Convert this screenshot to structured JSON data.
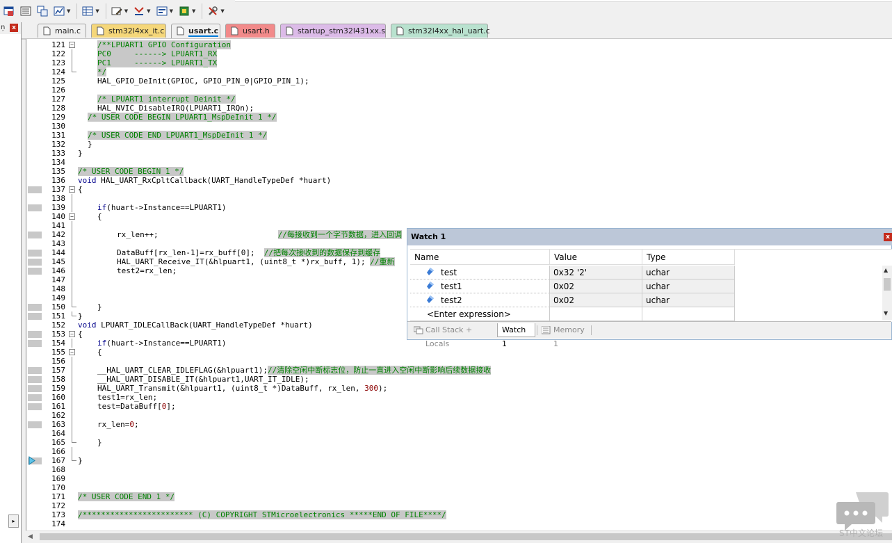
{
  "toolbar": {
    "icons": [
      "window-icon",
      "list-icon",
      "registers-icon",
      "disassembly-icon",
      "grid-icon",
      "memory-icon",
      "callstack-icon",
      "watch-icon",
      "cpu-icon",
      "tools-icon"
    ]
  },
  "left_panel": {
    "pin": "ņ",
    "close": "x",
    "scroll": "▸"
  },
  "tabs": [
    {
      "label": "main.c",
      "color": "#f0f0f0"
    },
    {
      "label": "stm32l4xx_it.c",
      "color": "#f5d77a"
    },
    {
      "label": "usart.c",
      "color": "#f0f0f0",
      "active": true
    },
    {
      "label": "usart.h",
      "color": "#f28a8a"
    },
    {
      "label": "startup_stm32l431xx.s",
      "color": "#dcbbe8"
    },
    {
      "label": "stm32l4xx_hal_uart.c",
      "color": "#b9e2cf"
    }
  ],
  "code": {
    "l121_n": "121",
    "l121": "/**LPUART1 GPIO Configuration",
    "l122_n": "122",
    "l122": "PC0     ------> LPUART1_RX",
    "l123_n": "123",
    "l123": "PC1     ------> LPUART1_TX",
    "l124_n": "124",
    "l124": "*/",
    "l125_n": "125",
    "l125": "HAL_GPIO_DeInit(GPIOC, GPIO_PIN_0|GPIO_PIN_1);",
    "l126_n": "126",
    "l127_n": "127",
    "l127": "/* LPUART1 interrupt Deinit */",
    "l128_n": "128",
    "l128": "HAL_NVIC_DisableIRQ(LPUART1_IRQn);",
    "l129_n": "129",
    "l129": "/* USER CODE BEGIN LPUART1_MspDeInit 1 */",
    "l130_n": "130",
    "l131_n": "131",
    "l131": "/* USER CODE END LPUART1_MspDeInit 1 */",
    "l132_n": "132",
    "l132": "}",
    "l133_n": "133",
    "l133": "}",
    "l134_n": "134",
    "l135_n": "135",
    "l135": "/* USER CODE BEGIN 1 */",
    "l136_n": "136",
    "l136_kw": "void",
    "l136": " HAL_UART_RxCpltCallback(UART_HandleTypeDef *huart)",
    "l137_n": "137",
    "l137": "{",
    "l138_n": "138",
    "l139_n": "139",
    "l139_kw": "if",
    "l139": "(huart->Instance==LPUART1)",
    "l140_n": "140",
    "l140": "{",
    "l141_n": "141",
    "l142_n": "142",
    "l142": "rx_len++;                          ",
    "l142_cm": "//每接收到一个字节数据，进入回调",
    "l143_n": "143",
    "l144_n": "144",
    "l144": "DataBuff[rx_len-1]=rx_buff[0];  ",
    "l144_cm": "//把每次接收到的数据保存到缓存",
    "l145_n": "145",
    "l145": "HAL_UART_Receive_IT(&hlpuart1, (uint8_t *)rx_buff, 1); ",
    "l145_num": "1",
    "l145_cm": "//重新",
    "l146_n": "146",
    "l146": "test2=rx_len;",
    "l147_n": "147",
    "l148_n": "148",
    "l149_n": "149",
    "l150_n": "150",
    "l150": "}",
    "l151_n": "151",
    "l151": "}",
    "l152_n": "152",
    "l152_kw": "void",
    "l152": " LPUART_IDLECallBack(UART_HandleTypeDef *huart)",
    "l153_n": "153",
    "l153": "{",
    "l154_n": "154",
    "l154_kw": "if",
    "l154": "(huart->Instance==LPUART1)",
    "l155_n": "155",
    "l155": "{",
    "l156_n": "156",
    "l157_n": "157",
    "l157": "__HAL_UART_CLEAR_IDLEFLAG(&hlpuart1);",
    "l157_cm": "//清除空闲中断标志位，防止一直进入空闲中断影响后续数据接收",
    "l158_n": "158",
    "l158": "__HAL_UART_DISABLE_IT(&hlpuart1,UART_IT_IDLE);",
    "l159_n": "159",
    "l159": "HAL_UART_Transmit(&hlpuart1, (uint8_t *)DataBuff, rx_len, ",
    "l159_num": "300",
    "l159_end": ");",
    "l160_n": "160",
    "l160": "test1=rx_len;",
    "l161_n": "161",
    "l161": "test=DataBuff[",
    "l161_num": "0",
    "l161_end": "];",
    "l162_n": "162",
    "l163_n": "163",
    "l163": "rx_len=",
    "l163_num": "0",
    "l163_end": ";",
    "l164_n": "164",
    "l165_n": "165",
    "l165": "}",
    "l166_n": "166",
    "l167_n": "167",
    "l167": "}",
    "l168_n": "168",
    "l169_n": "169",
    "l170_n": "170",
    "l171_n": "171",
    "l171": "/* USER CODE END 1 */",
    "l172_n": "172",
    "l173_n": "173",
    "l173": "/************************ (C) COPYRIGHT STMicroelectronics *****END OF FILE****/",
    "l174_n": "174"
  },
  "watch": {
    "title": "Watch 1",
    "close": "x",
    "columns": {
      "name": "Name",
      "value": "Value",
      "type": "Type"
    },
    "rows": [
      {
        "name": "test",
        "value": "0x32 '2'",
        "type": "uchar"
      },
      {
        "name": "test1",
        "value": "0x02",
        "type": "uchar"
      },
      {
        "name": "test2",
        "value": "0x02",
        "type": "uchar"
      }
    ],
    "enter_expression": "<Enter expression>",
    "tabs": {
      "callstack": "Call Stack + Locals",
      "watch": "Watch 1",
      "memory": "Memory 1"
    }
  },
  "brand": "ST中文论坛",
  "colors": {
    "comment": "#008000",
    "keyword": "#00008b",
    "number": "#8b0000",
    "highlight": "#c8c8c8",
    "watch_title": "#bcc7d8"
  }
}
